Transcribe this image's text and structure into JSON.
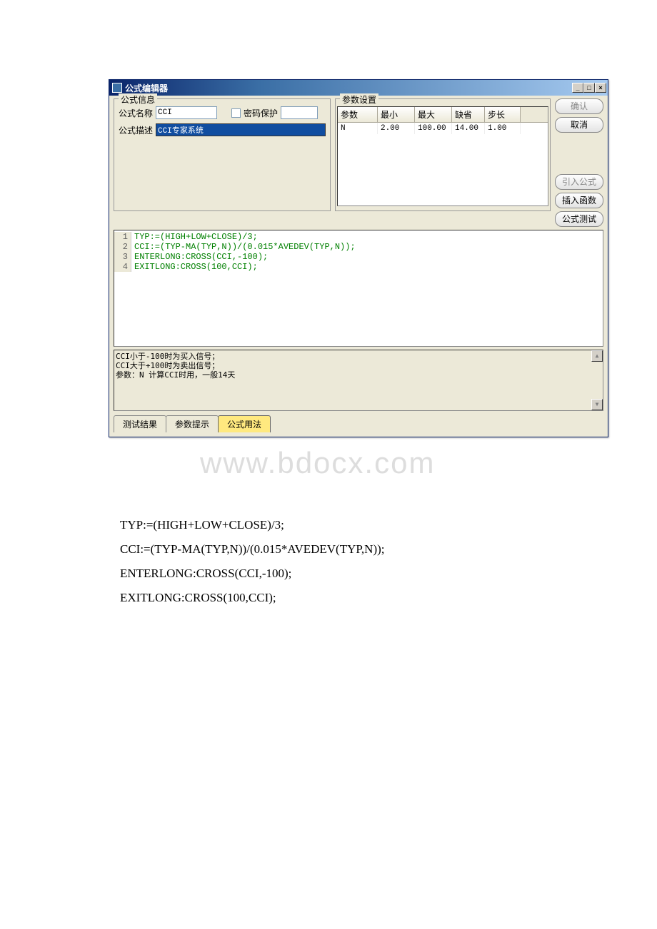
{
  "window": {
    "title": "公式编辑器",
    "min": "_",
    "max": "□",
    "close": "×"
  },
  "formula_info": {
    "legend": "公式信息",
    "name_label": "公式名称",
    "name_value": "CCI",
    "pw_label": "密码保护",
    "desc_label": "公式描述",
    "desc_value": "CCI专家系统"
  },
  "param_set": {
    "legend": "参数设置",
    "headers": [
      "参数",
      "最小",
      "最大",
      "缺省",
      "步长"
    ],
    "rows": [
      {
        "name": "N",
        "min": "2.00",
        "max": "100.00",
        "def": "14.00",
        "step": "1.00"
      }
    ]
  },
  "buttons": {
    "ok": "确认",
    "cancel": "取消",
    "import": "引入公式",
    "insert_fn": "插入函数",
    "test": "公式测试"
  },
  "code": [
    "TYP:=(HIGH+LOW+CLOSE)/3;",
    "CCI:=(TYP-MA(TYP,N))/(0.015*AVEDEV(TYP,N));",
    "ENTERLONG:CROSS(CCI,-100);",
    "EXITLONG:CROSS(100,CCI);"
  ],
  "notes": "CCI小于-100时为买入信号；\nCCI大于+100时为卖出信号；\n参数：N  计算CCI时用，一般14天",
  "tabs": [
    "测试结果",
    "参数提示",
    "公式用法"
  ],
  "active_tab": 2,
  "watermark": "www.bdocx.com",
  "below_code": [
    "TYP:=(HIGH+LOW+CLOSE)/3;",
    "CCI:=(TYP-MA(TYP,N))/(0.015*AVEDEV(TYP,N));",
    "ENTERLONG:CROSS(CCI,-100);",
    "EXITLONG:CROSS(100,CCI);"
  ]
}
